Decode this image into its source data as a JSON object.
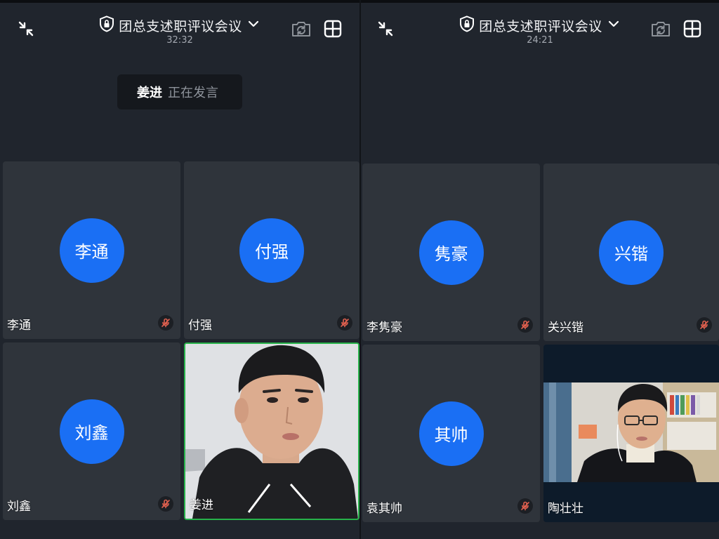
{
  "left": {
    "title": "团总支述职评议会议",
    "timer": "32:32",
    "speaker": {
      "name": "姜进",
      "status": "正在发言"
    },
    "tiles": [
      {
        "avatar": "李通",
        "name": "李通"
      },
      {
        "avatar": "付强",
        "name": "付强"
      },
      {
        "avatar": "刘鑫",
        "name": "刘鑫"
      },
      {
        "name": "姜进"
      }
    ]
  },
  "right": {
    "title": "团总支述职评议会议",
    "timer": "24:21",
    "tiles": [
      {
        "avatar": "隽豪",
        "name": "李隽豪"
      },
      {
        "avatar": "兴锴",
        "name": "关兴锴"
      },
      {
        "avatar": "其帅",
        "name": "袁其帅"
      },
      {
        "name": "陶壮壮"
      }
    ]
  },
  "colors": {
    "avatar": "#1a6ff4",
    "tile": "#2f343b",
    "background": "#20252d",
    "active_speaker_border": "#27b24a",
    "muted_icon": "#e0604f"
  },
  "icons": [
    "collapse-icon",
    "shield-lock-icon",
    "chevron-down-icon",
    "camera-switch-icon",
    "grid-layout-icon",
    "mic-muted-icon"
  ]
}
